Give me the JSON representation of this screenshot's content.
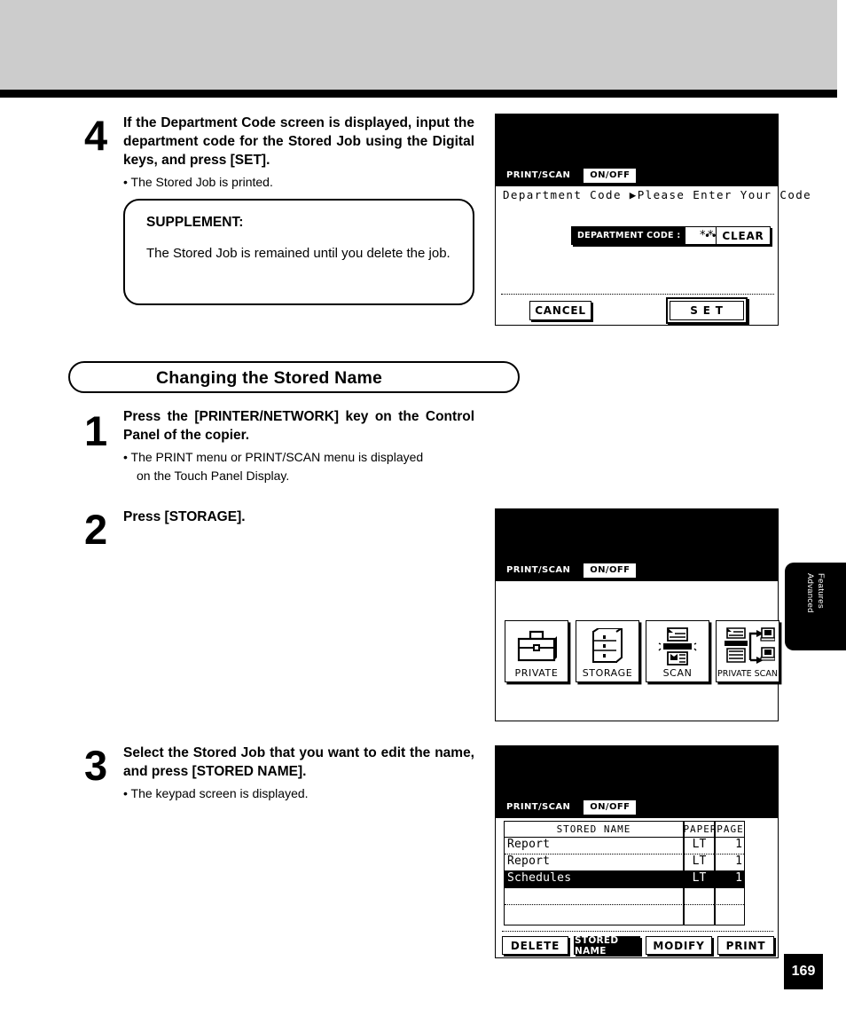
{
  "page": {
    "number": "169",
    "side_tab": "Advanced\nFeatures",
    "side_tab_line1": "Advanced",
    "side_tab_line2": "Features"
  },
  "steps": [
    {
      "number": "4",
      "heading": "If the Department Code screen is displayed, input the department code for the Stored Job using the Digital keys, and press [SET].",
      "bullet": "• The Stored Job is printed."
    },
    {
      "number": "1",
      "heading": "Press the [PRINTER/NETWORK] key on the Control Panel of the copier.",
      "bullet": "• The PRINT menu or PRINT/SCAN menu is displayed",
      "bullet_cont": "on the Touch Panel Display."
    },
    {
      "number": "2",
      "heading": "Press [STORAGE]."
    },
    {
      "number": "3",
      "heading": "Select the Stored Job that you want to edit the name, and press [STORED NAME].",
      "bullet": "• The keypad screen is displayed."
    }
  ],
  "supplement": {
    "title": "SUPPLEMENT:",
    "text": "The Stored Job is remained until you delete the job."
  },
  "section": {
    "title": "Changing the Stored Name"
  },
  "lcd1": {
    "tabs": [
      {
        "label": "PRINT/SCAN",
        "selected": true
      },
      {
        "label": "ON/OFF",
        "selected": false
      }
    ],
    "status_line": "Department Code  ▶Please Enter Your Code",
    "code_label": "DEPARTMENT CODE :",
    "code_value": "*****",
    "connector": "•••",
    "clear_button": "CLEAR",
    "cancel_button": "CANCEL",
    "set_button": "S E T"
  },
  "lcd2": {
    "tabs": [
      {
        "label": "PRINT/SCAN",
        "selected": true
      },
      {
        "label": "ON/OFF",
        "selected": false
      }
    ],
    "buttons": [
      {
        "label": "PRIVATE",
        "icon": "briefcase-icon"
      },
      {
        "label": "STORAGE",
        "icon": "file-cabinet-icon"
      },
      {
        "label": "SCAN",
        "icon": "scanner-icon"
      },
      {
        "label": "PRIVATE SCAN",
        "icon": "scanner-to-computers-icon"
      }
    ]
  },
  "lcd3": {
    "tabs": [
      {
        "label": "PRINT/SCAN",
        "selected": true
      },
      {
        "label": "ON/OFF",
        "selected": false
      }
    ],
    "table": {
      "columns": [
        "STORED NAME",
        "PAPER",
        "PAGE"
      ],
      "rows": [
        {
          "name": "Report",
          "paper": "LT",
          "page": "1",
          "selected": false
        },
        {
          "name": "Report",
          "paper": "LT",
          "page": "1",
          "selected": false
        },
        {
          "name": "Schedules",
          "paper": "LT",
          "page": "1",
          "selected": true
        },
        {
          "name": "",
          "paper": "",
          "page": "",
          "selected": false
        },
        {
          "name": "",
          "paper": "",
          "page": "",
          "selected": false
        }
      ]
    },
    "buttons": [
      {
        "label": "DELETE",
        "selected": false
      },
      {
        "label": "STORED NAME",
        "selected": true
      },
      {
        "label": "MODIFY",
        "selected": false
      },
      {
        "label": "PRINT",
        "selected": false
      }
    ]
  }
}
